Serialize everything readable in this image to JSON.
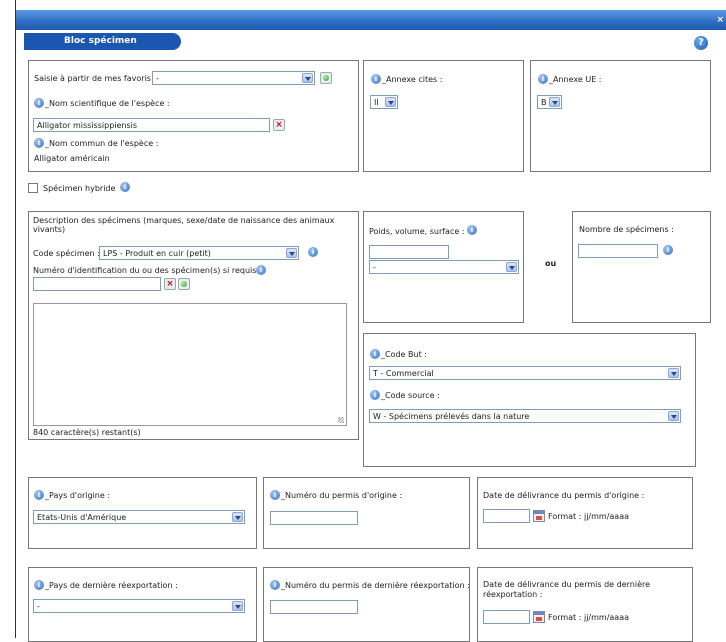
{
  "dialog": {
    "section_title": "Bloc spécimen",
    "close": "×",
    "help": "?"
  },
  "favorites": {
    "label": "Saisie à partir de mes favoris :",
    "value": "-"
  },
  "scientific_name": {
    "label": "_Nom scientifique de l'espèce :",
    "value": "Alligator mississippiensis",
    "clear": "×"
  },
  "common_name": {
    "label": "_Nom commun de l'espèce :",
    "value": "Alligator américain"
  },
  "annexe_cites": {
    "label": "_Annexe cites :",
    "value": "II"
  },
  "annexe_ue": {
    "label": "_Annexe UE :",
    "value": "B"
  },
  "hybrid": {
    "label": "Spécimen hybride",
    "checked": false
  },
  "description": {
    "label_line1": "Description des spécimens (marques, sexe/date de naissance des animaux",
    "label_line2": "vivants)",
    "code_label": "Code spécimen :",
    "code_value": "LPS - Produit en cuir (petit)",
    "id_label": "Numéro d'identification du ou des spécimen(s) si requis :",
    "id_value": "",
    "remaining": "840 caractère(s) restant(s)"
  },
  "weight": {
    "label": "Poids, volume, surface :",
    "value": "",
    "unit": "-"
  },
  "or_label": "ou",
  "count": {
    "label": "Nombre de spécimens :",
    "value": ""
  },
  "purpose": {
    "label": "_Code But :",
    "value": "T - Commercial"
  },
  "source": {
    "label": "_Code source :",
    "value": "W - Spécimens prélevés dans la nature"
  },
  "origin_country": {
    "label": "_Pays d'origine :",
    "value": "Etats-Unis d'Amérique"
  },
  "origin_permit": {
    "label": "_Numéro du permis d'origine :",
    "value": ""
  },
  "origin_date": {
    "label": "Date de délivrance du permis d'origine :",
    "value": "",
    "format": "Format : jj/mm/aaaa"
  },
  "reexport_country": {
    "label": "_Pays de dernière réexportation :",
    "value": "-"
  },
  "reexport_permit": {
    "label": "_Numéro du permis de dernière réexportation :",
    "value": ""
  },
  "reexport_date": {
    "label_line1": "Date de délivrance du permis de dernière",
    "label_line2": "réexportation :",
    "value": "",
    "format": "Format : jj/mm/aaaa"
  },
  "info_icon": "i",
  "colors": {
    "title_bar": "#2d6cc4",
    "section_tab": "#1b56b0"
  }
}
